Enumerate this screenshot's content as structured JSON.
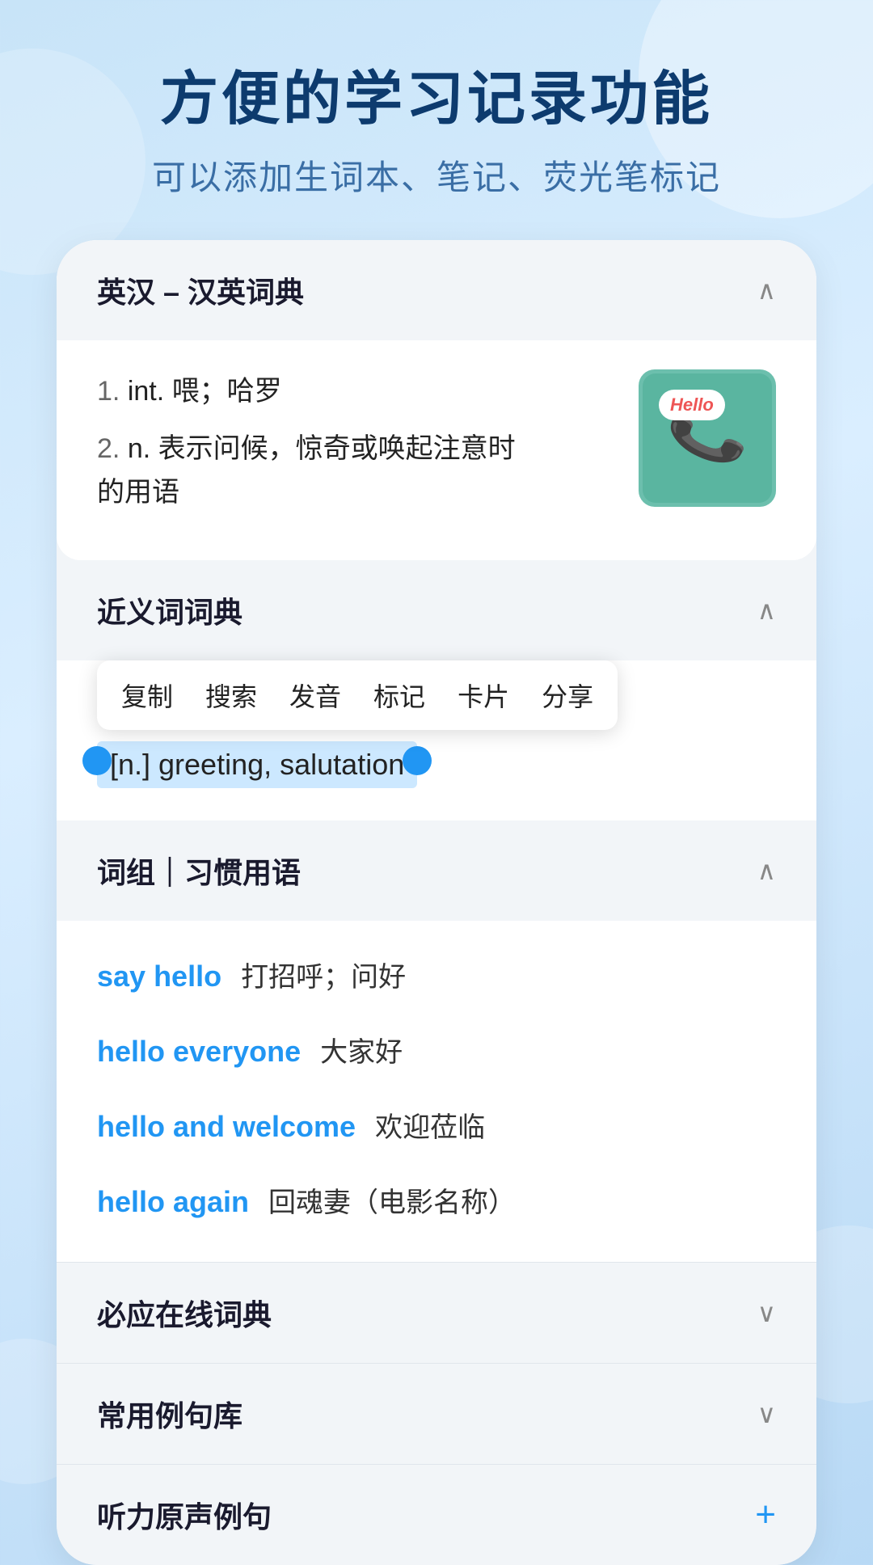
{
  "header": {
    "title": "方便的学习记录功能",
    "subtitle": "可以添加生词本、笔记、荧光笔标记"
  },
  "sections": {
    "dictionary": {
      "title": "英汉 – 汉英词典",
      "chevron": "∧",
      "definitions": [
        {
          "num": "1.",
          "type": "int.",
          "meaning": "喂；哈罗"
        },
        {
          "num": "2.",
          "type": "n.",
          "meaning": "表示问候，惊奇或唤起注意时的用语"
        }
      ],
      "image_label": "Hello telephone illustration"
    },
    "synonyms": {
      "title": "近义词词典",
      "chevron": "∧",
      "context_menu": {
        "items": [
          "复制",
          "搜索",
          "发音",
          "标记",
          "卡片",
          "分享"
        ]
      },
      "highlighted_text": "[n.] greeting, salutation"
    },
    "phrases": {
      "title": "词组｜习惯用语",
      "chevron": "∧",
      "items": [
        {
          "english": "say hello",
          "chinese": "打招呼；问好"
        },
        {
          "english": "hello everyone",
          "chinese": "大家好"
        },
        {
          "english": "hello and welcome",
          "chinese": "欢迎莅临"
        },
        {
          "english": "hello again",
          "chinese": "回魂妻（电影名称）"
        }
      ]
    },
    "biyingOnline": {
      "title": "必应在线词典",
      "chevron": "∨"
    },
    "commonSentences": {
      "title": "常用例句库",
      "chevron": "∨"
    },
    "listeningSentences": {
      "title": "听力原声例句",
      "plus": "+"
    }
  }
}
